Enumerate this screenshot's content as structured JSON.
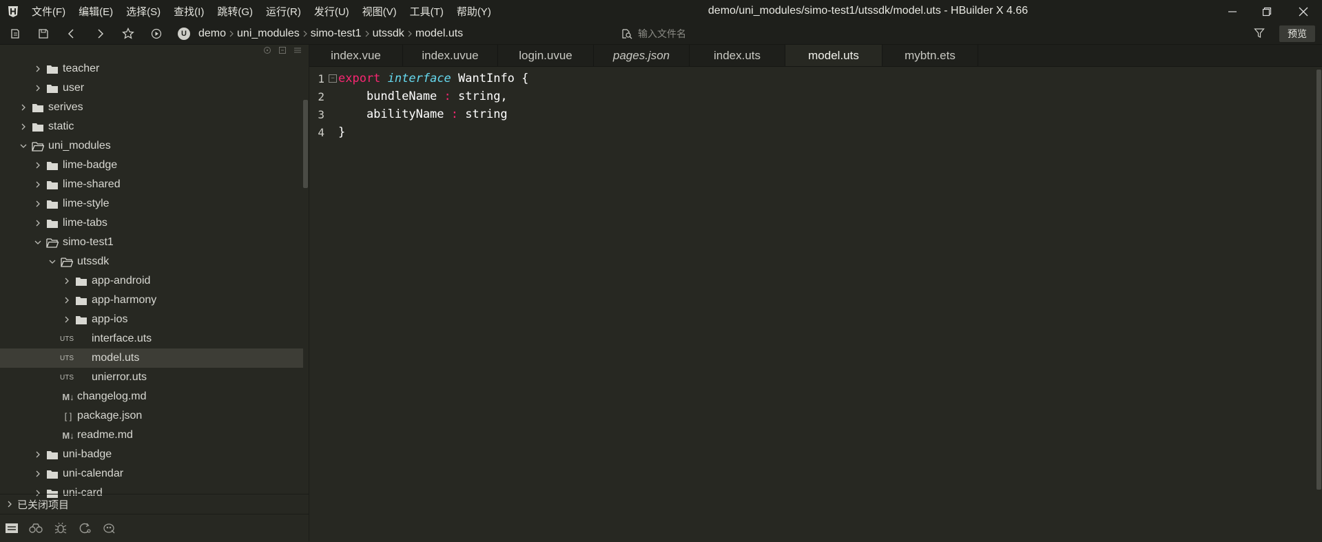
{
  "window": {
    "title": "demo/uni_modules/simo-test1/utssdk/model.uts - HBuilder X 4.66"
  },
  "menu": [
    {
      "id": "file",
      "label": "文件(F)"
    },
    {
      "id": "edit",
      "label": "编辑(E)"
    },
    {
      "id": "select",
      "label": "选择(S)"
    },
    {
      "id": "find",
      "label": "查找(I)"
    },
    {
      "id": "goto",
      "label": "跳转(G)"
    },
    {
      "id": "run",
      "label": "运行(R)"
    },
    {
      "id": "publish",
      "label": "发行(U)"
    },
    {
      "id": "view",
      "label": "视图(V)"
    },
    {
      "id": "tools",
      "label": "工具(T)"
    },
    {
      "id": "help",
      "label": "帮助(Y)"
    }
  ],
  "toolbar": {
    "breadcrumb": [
      "demo",
      "uni_modules",
      "simo-test1",
      "utssdk",
      "model.uts"
    ],
    "search_placeholder": "输入文件名",
    "preview_label": "预览",
    "project_badge": "U"
  },
  "sidebar": {
    "tree": [
      {
        "label": "teacher",
        "level": 2,
        "type": "folder",
        "expanded": false
      },
      {
        "label": "user",
        "level": 2,
        "type": "folder",
        "expanded": false
      },
      {
        "label": "serives",
        "level": 1,
        "type": "folder",
        "expanded": false
      },
      {
        "label": "static",
        "level": 1,
        "type": "folder",
        "expanded": false
      },
      {
        "label": "uni_modules",
        "level": 1,
        "type": "folder",
        "expanded": true
      },
      {
        "label": "lime-badge",
        "level": 2,
        "type": "folder",
        "expanded": false
      },
      {
        "label": "lime-shared",
        "level": 2,
        "type": "folder",
        "expanded": false
      },
      {
        "label": "lime-style",
        "level": 2,
        "type": "folder",
        "expanded": false
      },
      {
        "label": "lime-tabs",
        "level": 2,
        "type": "folder",
        "expanded": false
      },
      {
        "label": "simo-test1",
        "level": 2,
        "type": "folder",
        "expanded": true
      },
      {
        "label": "utssdk",
        "level": 3,
        "type": "folder",
        "expanded": true
      },
      {
        "label": "app-android",
        "level": 4,
        "type": "folder",
        "expanded": false
      },
      {
        "label": "app-harmony",
        "level": 4,
        "type": "folder",
        "expanded": false
      },
      {
        "label": "app-ios",
        "level": 4,
        "type": "folder",
        "expanded": false
      },
      {
        "label": "interface.uts",
        "level": 4,
        "type": "uts"
      },
      {
        "label": "model.uts",
        "level": 4,
        "type": "uts",
        "selected": true
      },
      {
        "label": "unierror.uts",
        "level": 4,
        "type": "uts"
      },
      {
        "label": "changelog.md",
        "level": 3,
        "type": "md"
      },
      {
        "label": "package.json",
        "level": 3,
        "type": "json"
      },
      {
        "label": "readme.md",
        "level": 3,
        "type": "md"
      },
      {
        "label": "uni-badge",
        "level": 2,
        "type": "folder",
        "expanded": false
      },
      {
        "label": "uni-calendar",
        "level": 2,
        "type": "folder",
        "expanded": false
      },
      {
        "label": "uni-card",
        "level": 2,
        "type": "folder",
        "expanded": false
      }
    ],
    "uts_badge": "UTS",
    "md_badge": "M↓",
    "json_badge": "[ ]",
    "closed_projects_label": "已关闭项目"
  },
  "tabs": [
    {
      "label": "index.vue",
      "italic": false,
      "active": false
    },
    {
      "label": "index.uvue",
      "italic": false,
      "active": false
    },
    {
      "label": "login.uvue",
      "italic": false,
      "active": false
    },
    {
      "label": "pages.json",
      "italic": true,
      "active": false
    },
    {
      "label": "index.uts",
      "italic": false,
      "active": false
    },
    {
      "label": "model.uts",
      "italic": false,
      "active": true
    },
    {
      "label": "mybtn.ets",
      "italic": false,
      "active": false
    }
  ],
  "editor": {
    "lines": [
      {
        "num": "1",
        "tokens": [
          {
            "t": "export",
            "c": "kw"
          },
          {
            "t": " ",
            "c": "punct"
          },
          {
            "t": "interface",
            "c": "kw2"
          },
          {
            "t": " WantInfo {",
            "c": "ident"
          }
        ],
        "fold": true
      },
      {
        "num": "2",
        "tokens": [
          {
            "t": "    bundleName ",
            "c": "ident"
          },
          {
            "t": ":",
            "c": "colon"
          },
          {
            "t": " string,",
            "c": "ident"
          }
        ]
      },
      {
        "num": "3",
        "tokens": [
          {
            "t": "    abilityName ",
            "c": "ident"
          },
          {
            "t": ":",
            "c": "colon"
          },
          {
            "t": " string",
            "c": "ident"
          }
        ]
      },
      {
        "num": "4",
        "tokens": [
          {
            "t": "}",
            "c": "ident"
          }
        ]
      }
    ]
  },
  "colors": {
    "keyword": "#f92672",
    "storage": "#66d9ef",
    "background": "#272822",
    "chrome": "#1e1f1b"
  }
}
